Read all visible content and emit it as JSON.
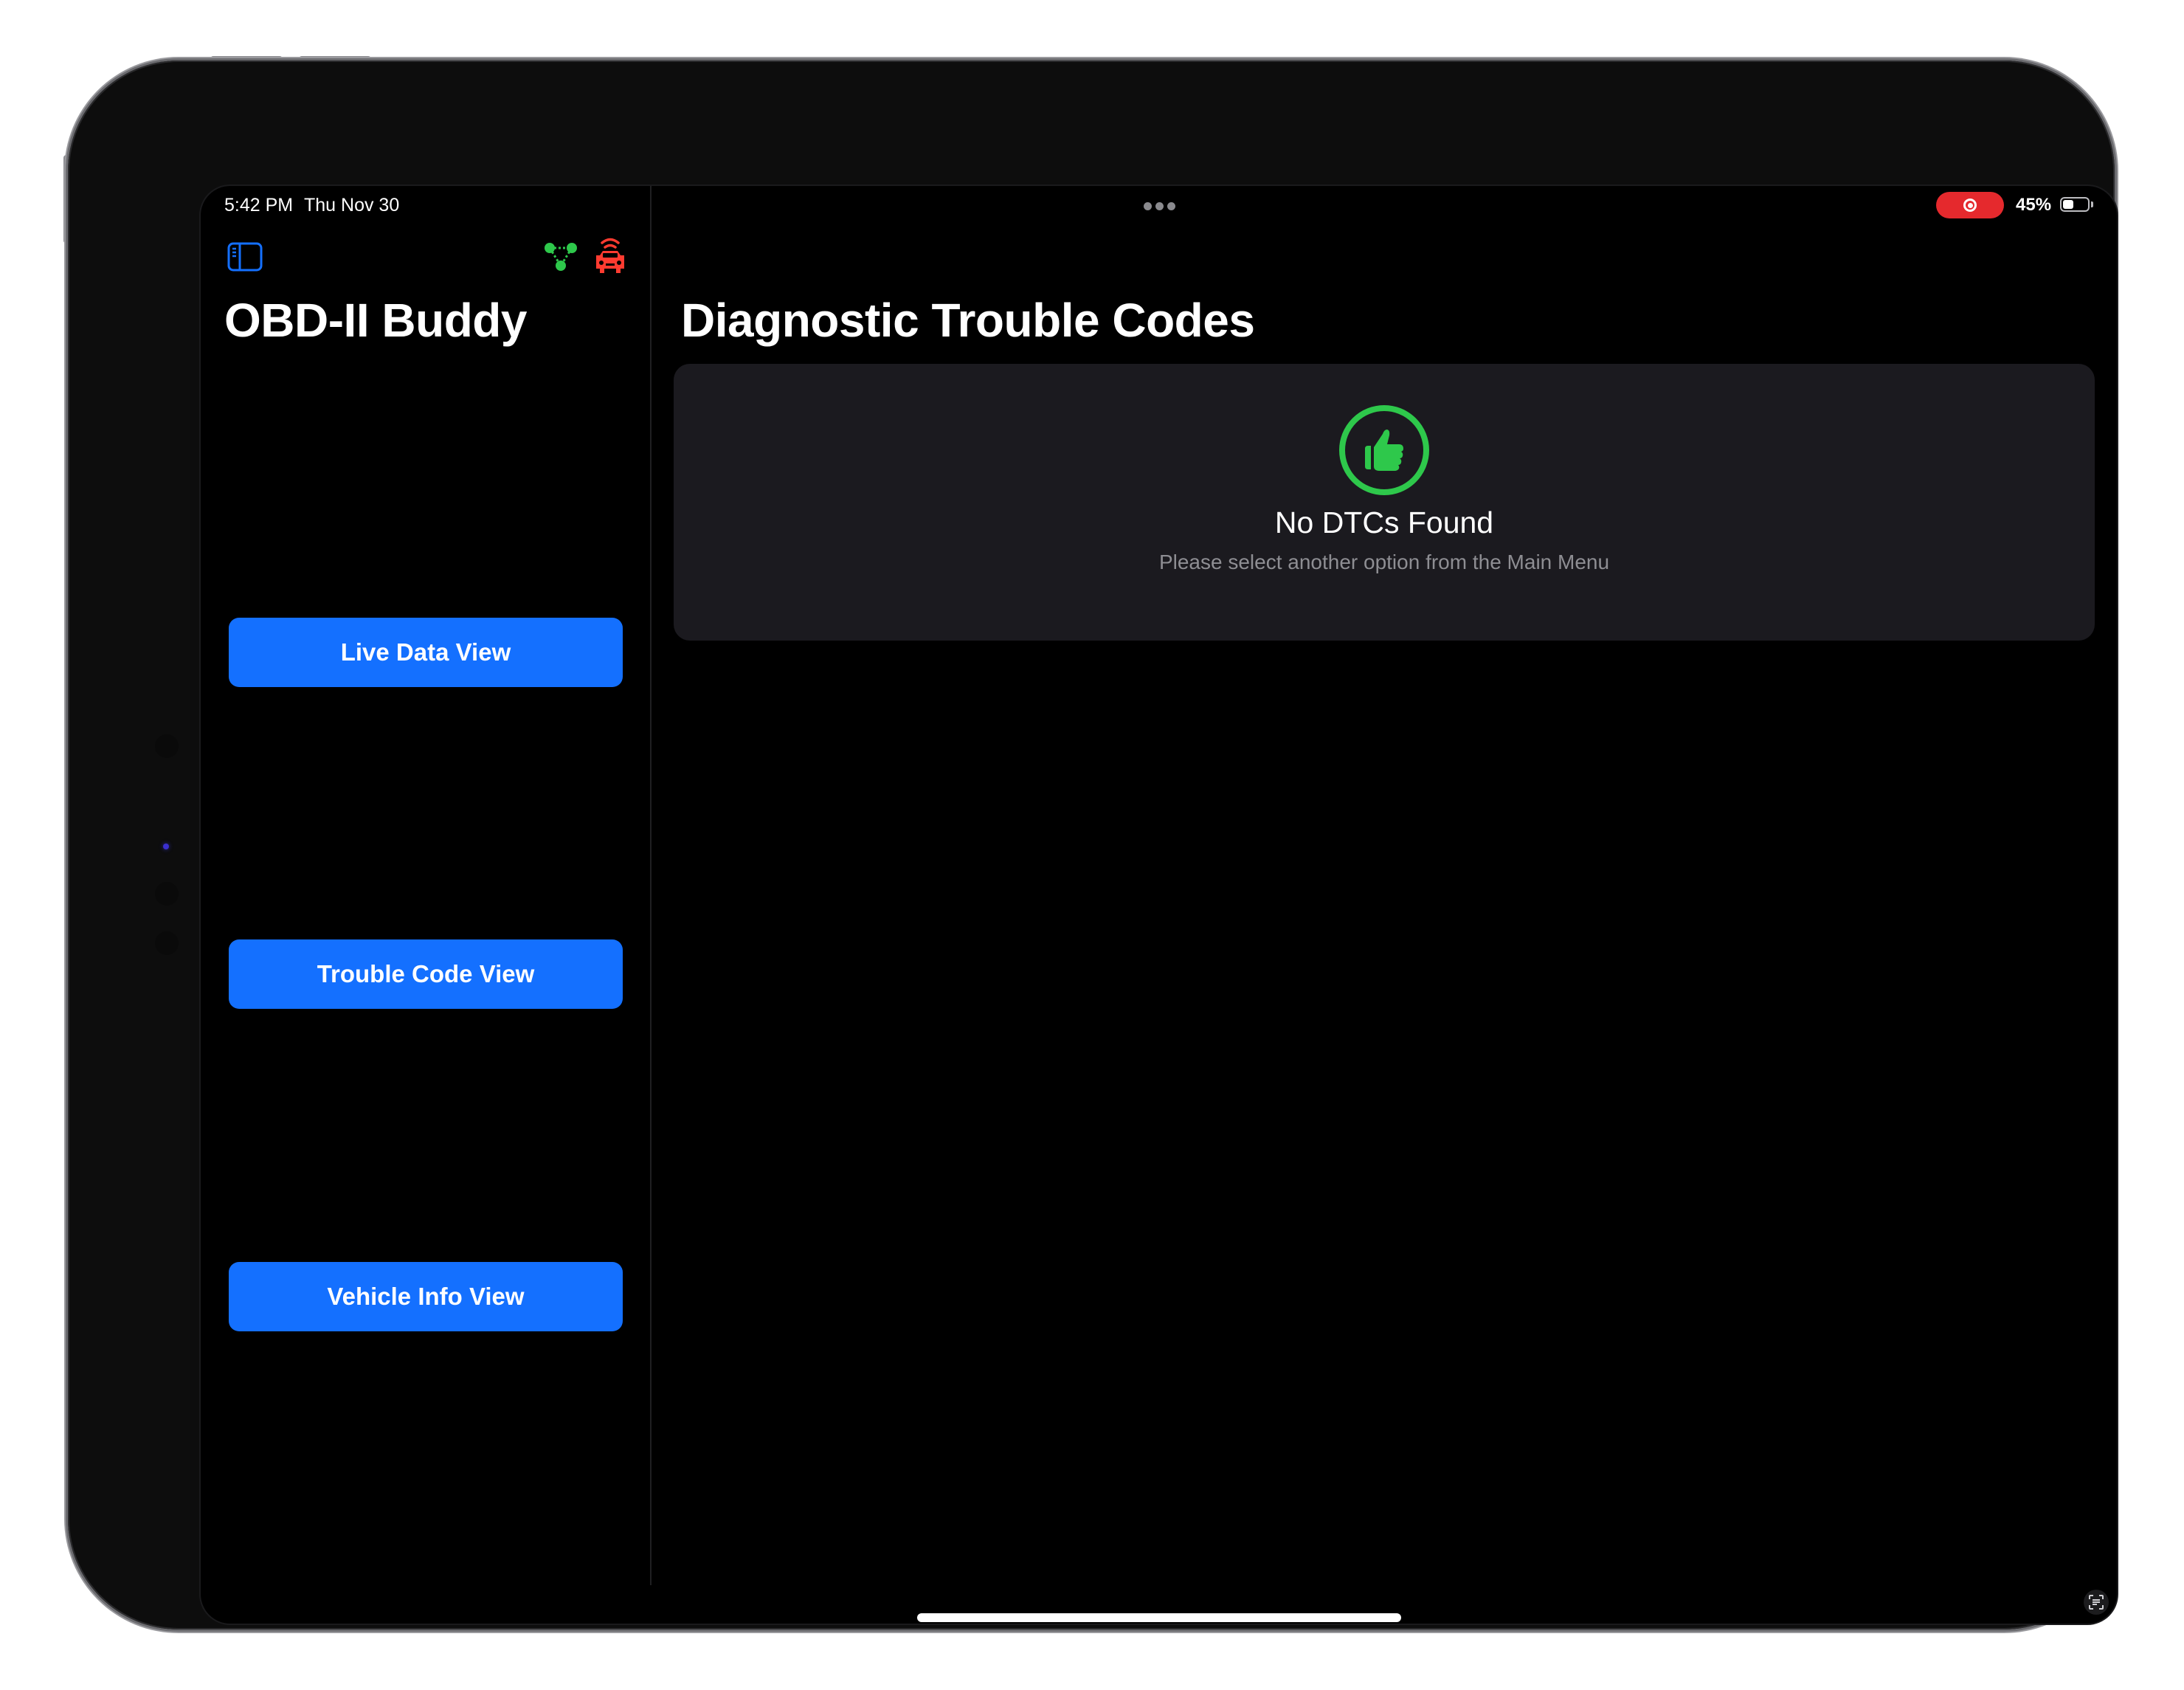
{
  "status_bar": {
    "time": "5:42 PM",
    "date": "Thu Nov 30",
    "battery_percent_label": "45%",
    "battery_level": 0.45,
    "recording_indicator_color": "#e5292d"
  },
  "sidebar": {
    "app_title": "OBD-II Buddy",
    "toolbar_icons": [
      {
        "name": "sidebar-toggle-icon",
        "color": "#1470ff"
      },
      {
        "name": "network-connection-icon",
        "color": "#2ec84b"
      },
      {
        "name": "car-connection-icon",
        "color": "#ff3b30"
      }
    ],
    "menu_buttons": [
      {
        "label": "Live Data View"
      },
      {
        "label": "Trouble Code View"
      },
      {
        "label": "Vehicle Info View"
      }
    ]
  },
  "detail": {
    "title": "Diagnostic Trouble Codes",
    "empty_state": {
      "icon": "thumbs-up-icon",
      "icon_color": "#2ec84b",
      "heading": "No DTCs Found",
      "message": "Please select another option from the Main Menu"
    }
  },
  "colors": {
    "accent": "#1470ff",
    "success": "#2ec84b",
    "error": "#ff3b30",
    "card_background": "#1b1a1f",
    "secondary_text": "#8e8e93"
  }
}
